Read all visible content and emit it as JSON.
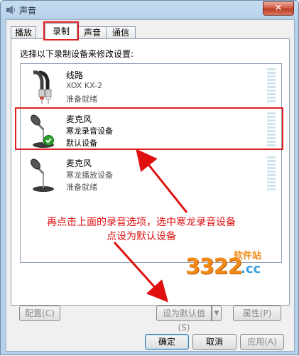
{
  "window": {
    "title": "声音",
    "close_glyph": "✕"
  },
  "tabs": [
    {
      "label": "播放",
      "active": false
    },
    {
      "label": "录制",
      "active": true
    },
    {
      "label": "声音",
      "active": false
    },
    {
      "label": "通信",
      "active": false
    }
  ],
  "instruction": "选择以下录制设备来修改设置:",
  "devices": [
    {
      "name": "线路",
      "model": "XOX KX-2",
      "status": "准备就绪",
      "icon": "line-in-cable-icon",
      "default": false,
      "selected": false
    },
    {
      "name": "麦克风",
      "model": "寒龙录音设备",
      "status": "默认设备",
      "icon": "microphone-icon",
      "default": true,
      "selected": true
    },
    {
      "name": "麦克风",
      "model": "寒龙播放设备",
      "status": "准备就绪",
      "icon": "microphone-icon",
      "default": false,
      "selected": false
    }
  ],
  "annotation": {
    "line1": "再点击上面的录音选项，选中寒龙录音设备",
    "line2": "点设为默认设备",
    "color": "#e01010"
  },
  "watermark": {
    "brand": "3322",
    "suffix": ".cc",
    "tag": "软件站"
  },
  "panel_buttons": {
    "configure": "配置(C)",
    "set_default": "设为默认值(S)",
    "properties": "属性(P)"
  },
  "dialog_buttons": {
    "ok": "确定",
    "cancel": "取消",
    "apply": "应用(A)"
  },
  "colors": {
    "highlight_red": "#e02020",
    "accent_orange": "#f08a1a"
  }
}
